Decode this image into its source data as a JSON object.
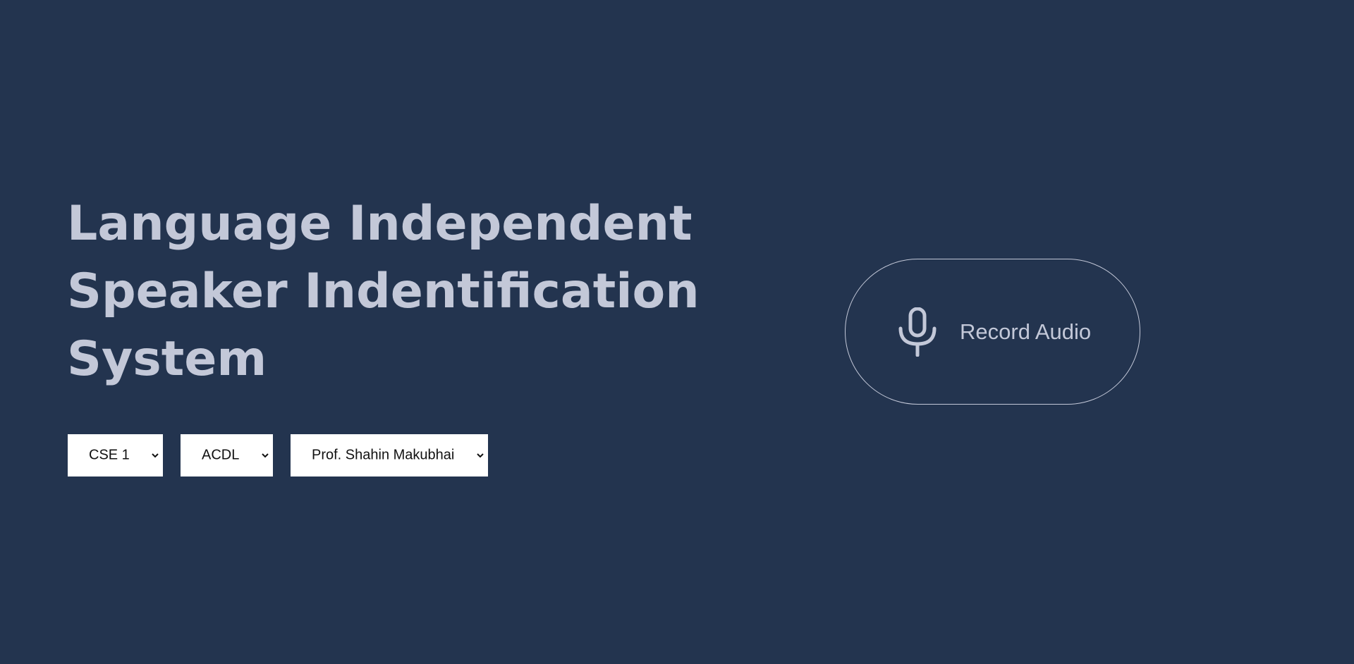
{
  "page": {
    "title_lines": [
      "Language Independent",
      "Speaker Indentification",
      "System"
    ]
  },
  "filters": {
    "class": {
      "selected": "CSE 1"
    },
    "subject": {
      "selected": "ACDL"
    },
    "professor": {
      "selected": "Prof. Shahin Makubhai"
    }
  },
  "record": {
    "label": "Record Audio",
    "icon": "microphone-icon"
  },
  "colors": {
    "background": "#23344f",
    "text": "#c3c8d8",
    "select_bg": "#ffffff"
  }
}
